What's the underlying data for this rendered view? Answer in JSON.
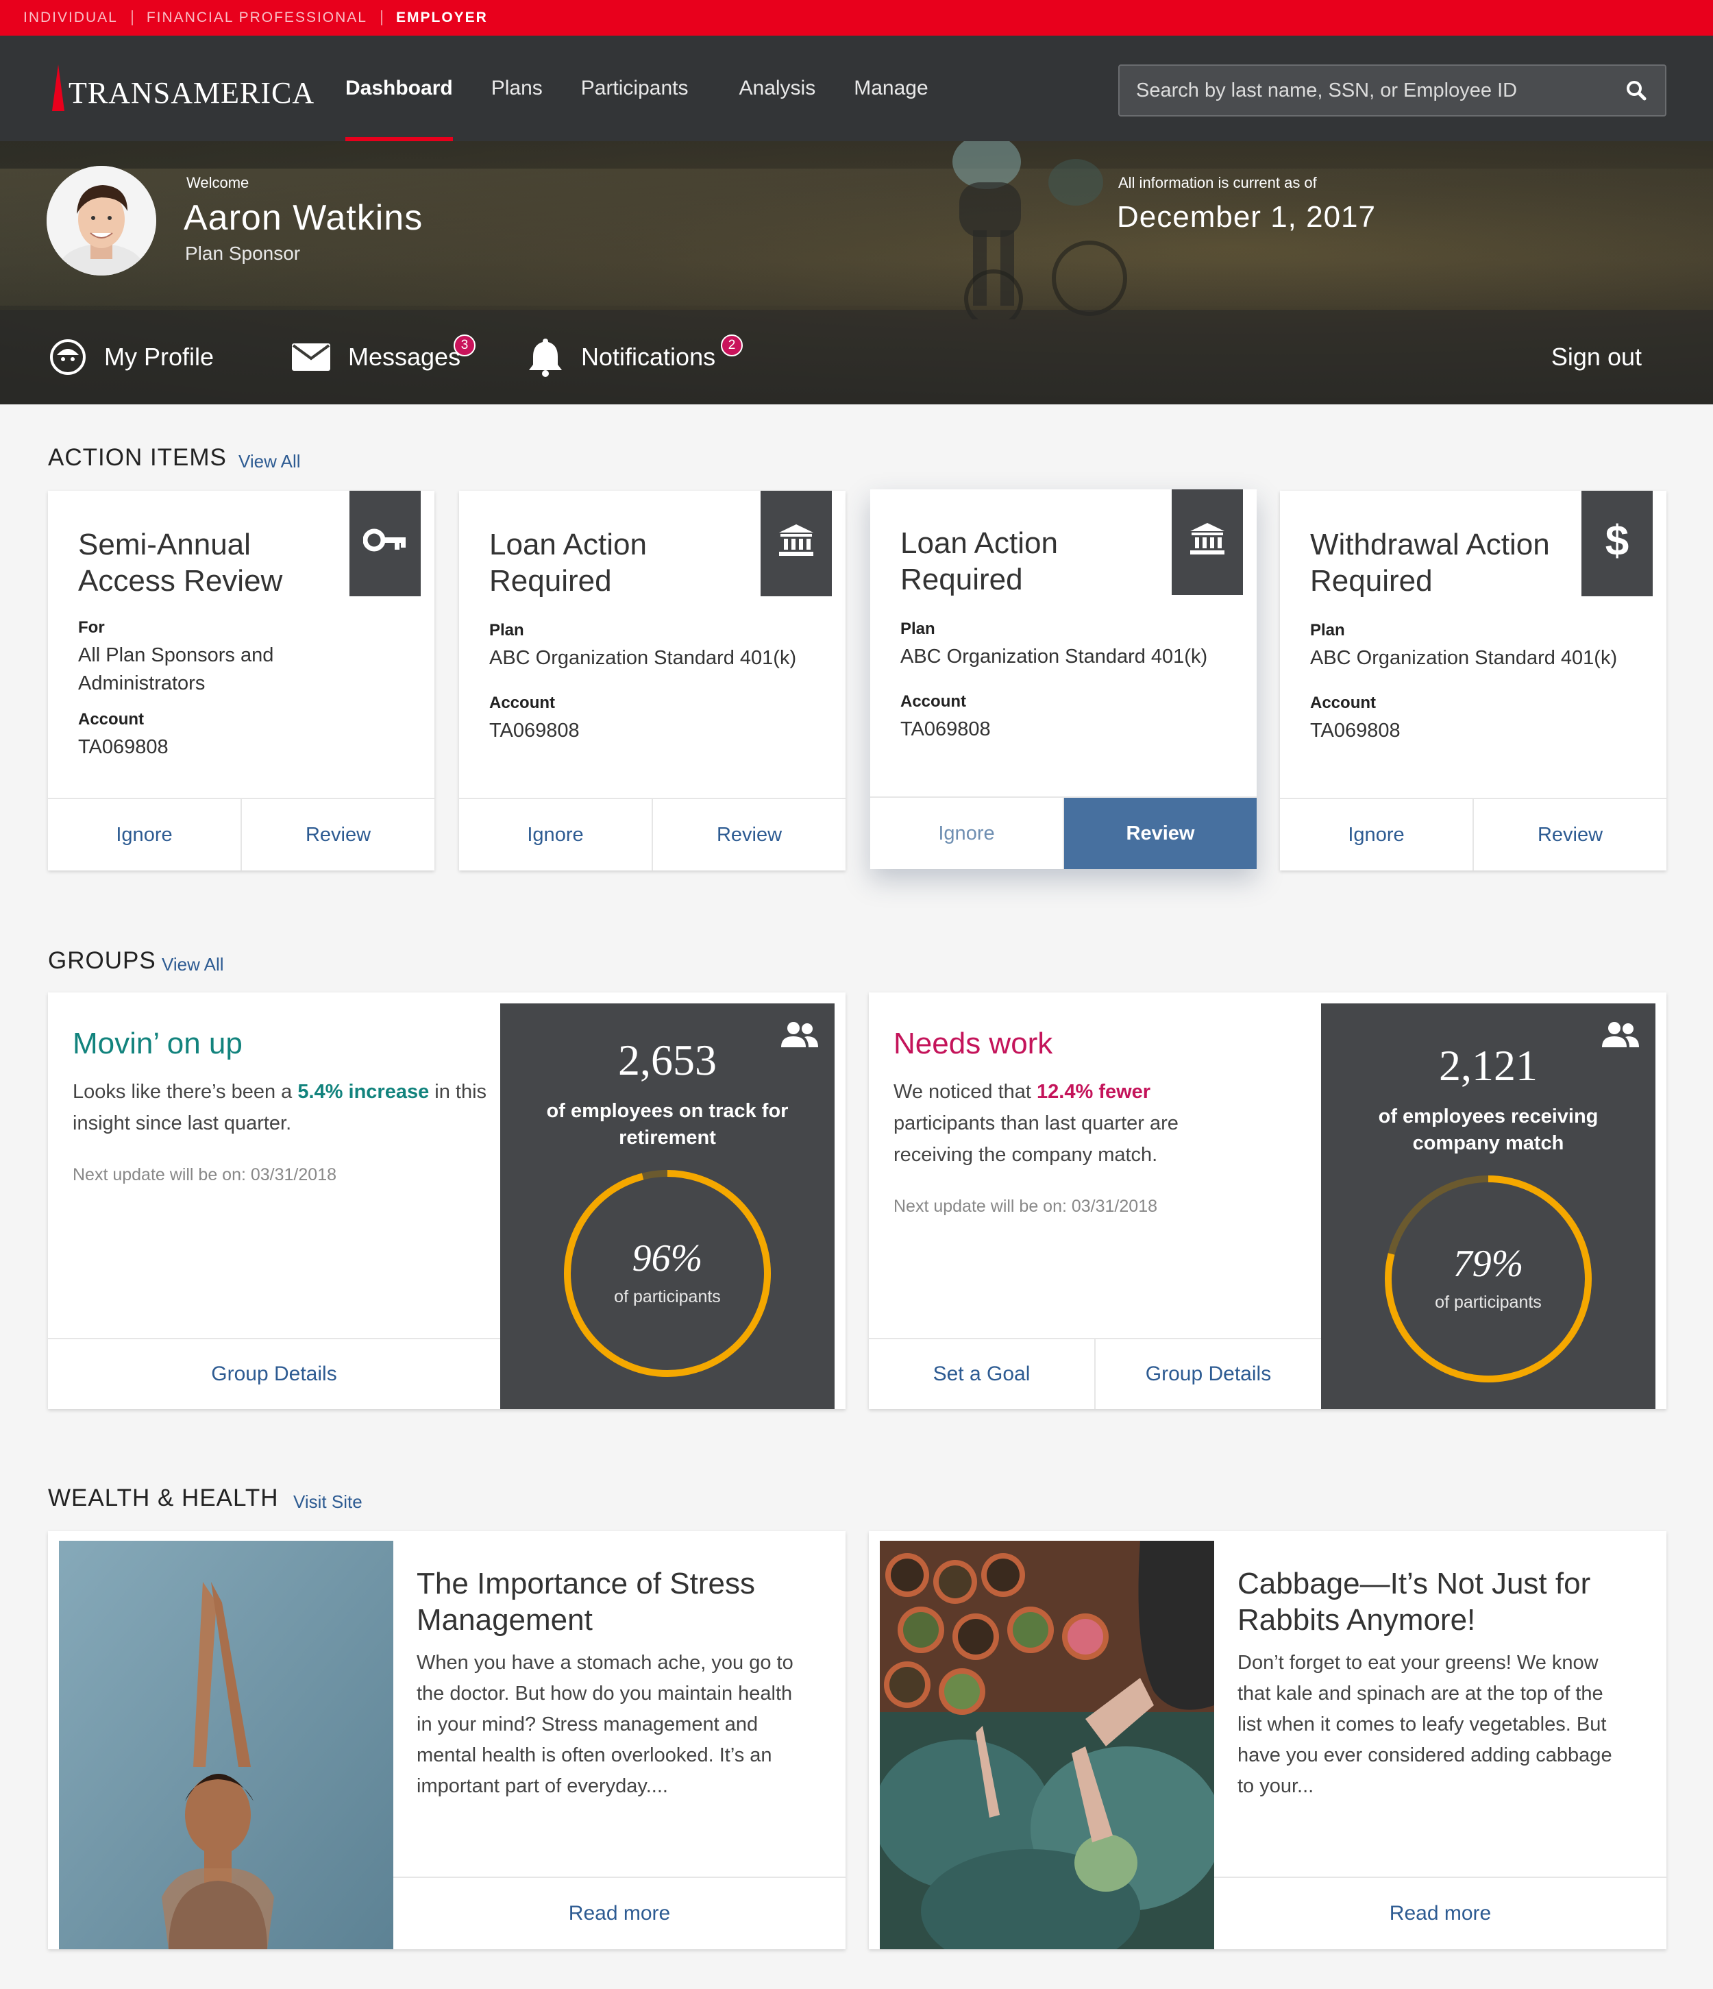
{
  "audience": [
    "Individual",
    "Financial Professional",
    "Employer"
  ],
  "brand": {
    "name": "TRANSAMERICA",
    "accent": "#e8001c",
    "link": "#2d5b92"
  },
  "nav": {
    "items": [
      "Dashboard",
      "Plans",
      "Participants",
      "Analysis",
      "Manage"
    ],
    "active": "Dashboard",
    "search_placeholder": "Search by last name, SSN, or Employee ID",
    "search_icon": "search-icon"
  },
  "user": {
    "welcome": "Welcome",
    "name": "Aaron Watkins",
    "role": "Plan Sponsor"
  },
  "asof": {
    "label": "All information is current as of",
    "date": "December 1, 2017"
  },
  "subnav": {
    "profile": "My Profile",
    "messages": "Messages",
    "messages_count": "3",
    "notifications": "Notifications",
    "notifications_count": "2",
    "signout": "Sign out"
  },
  "action_items": {
    "title": "ACTION ITEMS",
    "link": "View All",
    "cards": [
      {
        "title": "Semi-Annual Access Review",
        "icon": "key-icon",
        "f1_label": "For",
        "f1_value": "All Plan Sponsors and Administrators",
        "f2_label": "Account",
        "f2_value": "TA069808",
        "ignore": "Ignore",
        "review": "Review"
      },
      {
        "title": "Loan Action Required",
        "icon": "bank-icon",
        "f1_label": "Plan",
        "f1_value": "ABC Organization Standard 401(k)",
        "f2_label": "Account",
        "f2_value": "TA069808",
        "ignore": "Ignore",
        "review": "Review"
      },
      {
        "title": "Loan Action Required",
        "icon": "bank-icon",
        "f1_label": "Plan",
        "f1_value": "ABC Organization Standard 401(k)",
        "f2_label": "Account",
        "f2_value": "TA069808",
        "ignore": "Ignore",
        "review": "Review"
      },
      {
        "title": "Withdrawal Action Required",
        "icon": "dollar-icon",
        "f1_label": "Plan",
        "f1_value": "ABC Organization Standard 401(k)",
        "f2_label": "Account",
        "f2_value": "TA069808",
        "ignore": "Ignore",
        "review": "Review"
      }
    ]
  },
  "groups": {
    "title": "GROUPS",
    "link": "View All",
    "cards": [
      {
        "title": "Movin’ on up",
        "title_color": "#12837d",
        "text_pre": "Looks like there’s been a ",
        "highlight": "5.4% increase",
        "text_post": " in this insight since last quarter.",
        "next_update": "Next update will be on: 03/31/2018",
        "buttons": [
          "Group Details"
        ],
        "count": "2,653",
        "count_desc": "of employees on track for retirement",
        "percent": 96,
        "percent_label": "96%",
        "percent_sub": "of participants",
        "icon": "people-icon"
      },
      {
        "title": "Needs work",
        "title_color": "#c4145a",
        "text_pre": "We noticed that ",
        "highlight": "12.4% fewer",
        "text_post": " participants than last quarter are receiving the company match.",
        "next_update": "Next update will be on: 03/31/2018",
        "buttons": [
          "Set a Goal",
          "Group Details"
        ],
        "count": "2,121",
        "count_desc": "of employees receiving company match",
        "percent": 79,
        "percent_label": "79%",
        "percent_sub": "of participants",
        "icon": "people-icon"
      }
    ],
    "ring_color": "#f5a800"
  },
  "wealth": {
    "title": "WEALTH & HEALTH",
    "link": "Visit Site",
    "cards": [
      {
        "title": "The Importance of Stress Management",
        "text": "When you have a stomach ache, you go to the doctor. But how do you maintain health in your mind? Stress management and mental health is often overlooked. It’s an important part of everyday....",
        "button": "Read more"
      },
      {
        "title": "Cabbage—It’s Not Just for Rabbits Anymore!",
        "text": "Don’t forget to eat your greens! We know that kale and spinach are at the top of the list when it comes to leafy vegetables. But have you ever considered adding cabbage to your...",
        "button": "Read more"
      }
    ]
  }
}
